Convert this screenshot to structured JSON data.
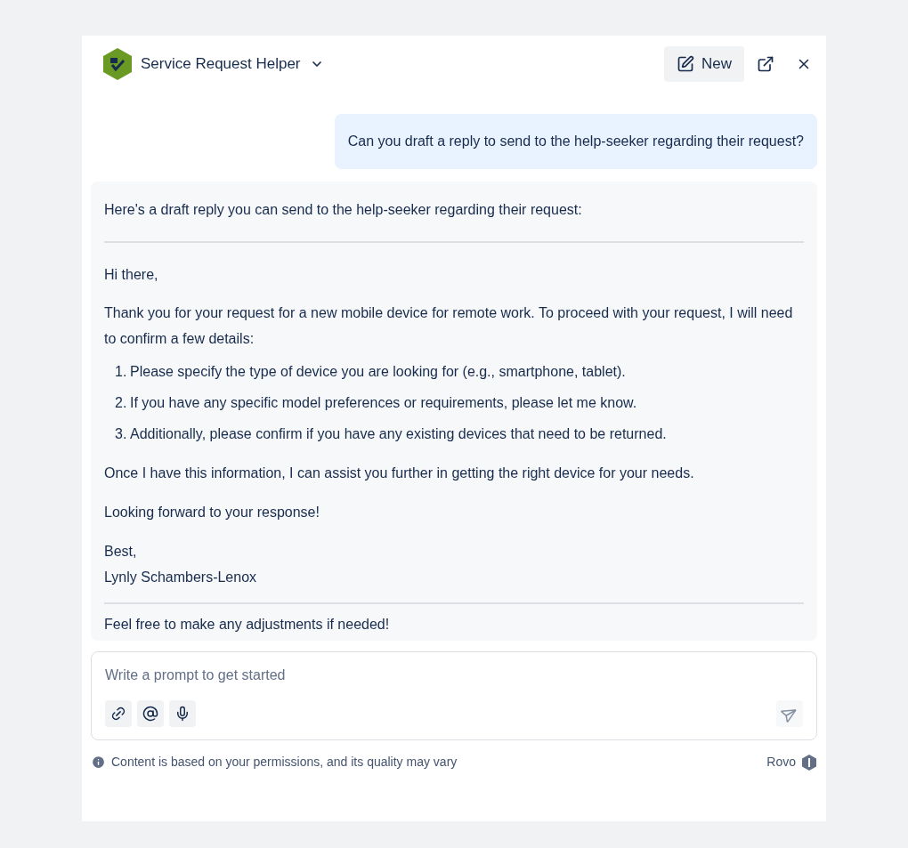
{
  "header": {
    "title": "Service Request Helper",
    "new_button": "New"
  },
  "user_message": "Can you draft a reply to send to the help-seeker regarding their request?",
  "reply": {
    "intro": "Here's a draft reply you can send to the help-seeker regarding their request:",
    "greeting": "Hi there,",
    "body": "Thank you for your request for a new mobile device for remote work. To proceed with your request, I will need to confirm a few details:",
    "list": [
      {
        "marker": "1.",
        "text": "Please specify the type of device you are looking for (e.g., smartphone, tablet)."
      },
      {
        "marker": "2.",
        "text": "If you have any specific model preferences or requirements, please let me know."
      },
      {
        "marker": "3.",
        "text": "Additionally, please confirm if you have any existing devices that need to be returned."
      }
    ],
    "closing": "Once I have this information, I can assist you further in getting the right device for your needs.",
    "sign_off": "Looking forward to your response!",
    "signature": [
      "Best,",
      "Lynly Schambers-Lenox"
    ],
    "outro": "Feel free to make any adjustments if needed!"
  },
  "composer": {
    "placeholder": "Write a prompt to get started"
  },
  "footer": {
    "notice": "Content is based on your permissions, and its quality may vary",
    "brand": "Rovo"
  }
}
